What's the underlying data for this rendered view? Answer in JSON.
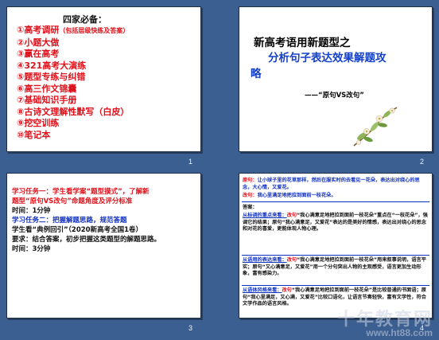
{
  "slide1": {
    "number": "1",
    "title": "四家必备：",
    "items": [
      {
        "label": "①高考调研",
        "sub": "（包括层级快练及答案）"
      },
      {
        "label": "②小题大做",
        "sub": ""
      },
      {
        "label": "③赢在高考",
        "sub": ""
      },
      {
        "label": "④321高考大演练",
        "sub": ""
      },
      {
        "label": "⑤题型专练与纠错",
        "sub": ""
      },
      {
        "label": "⑥高三作文锦囊",
        "sub": ""
      },
      {
        "label": "⑦基础知识手册",
        "sub": ""
      },
      {
        "label": "⑧古诗文理解性默写（白皮）",
        "sub": ""
      },
      {
        "label": "⑨挖空训练",
        "sub": ""
      },
      {
        "label": "⑩笔记本",
        "sub": ""
      }
    ]
  },
  "slide2": {
    "number": "2",
    "title_line1": "新高考语用新题型之",
    "title_line2": "分析句子表达效果解题攻",
    "title_line3": "略",
    "subtitle": "——“原句VS改句”"
  },
  "slide3": {
    "number": "3",
    "lines": [
      {
        "text": "学习任务一：学生看学案“题型摸式”，了解新",
        "color": "#e0101a"
      },
      {
        "text": "题型“原句VS改句”命题角度及评分标准",
        "color": "#e0101a"
      },
      {
        "text": "时间：1分钟",
        "color": "#111111"
      },
      {
        "text": "学习任务二：把握解题思路，规范答题",
        "color": "#1030c0"
      },
      {
        "text": "学生看“典例回引”（2020新高考全国1卷）",
        "color": "#111111"
      },
      {
        "text": "要求：结合答案，初步把握这类题型的解题思路。",
        "color": "#111111"
      },
      {
        "text": "时间：3分钟",
        "color": "#111111"
      }
    ]
  },
  "slide4": {
    "number": "4",
    "original_label": "原句：",
    "original_text": "让小球子里的花草那样，然后在服实时的去看见一花朵，表达出对绕心的思念，大心情，又爱花。",
    "revised_label": "改句：",
    "revised_text": "我心里满足地把拉到面前一枝花朵。",
    "answer_label": "答案：",
    "p1_head": "从标调的重点来看：",
    "p1_mid": "改句",
    "p1_text": "“我心满意足地把拉到面前一枝花朵”重点在“一枝花朵”，强调它的结果；",
    "p1_tail": "原句“我心满意足，又爱花”表达的是美好的情感，表达出对绕心的思念和对花的喜爱，更能体现人物心理。",
    "p2_head": "从语用的表达来看：",
    "p2_mid": "改句",
    "p2_text": "“我心满意足地把拉到面前一枝花朵”用来叙事说明，语言平实；",
    "p2_tail": "原句“又心满意足，又爱花”用一个分句突出人物的主观感受，语言更加生动形象，富有感染力。",
    "p3_head": "从语体风格来看：",
    "p3_mid": "改句",
    "p3_text": "“我心满意足地把拉到面前一枝花朵”是比较普通的书面语；",
    "p3_tail": "原句“我心里满足，又心满，又爱花”比较口语化，让语言节奏轻快，富有文学性，符合文学作品的语言风格。"
  },
  "watermark": {
    "big": "十年教育网",
    "url": "www.ht88.com"
  }
}
